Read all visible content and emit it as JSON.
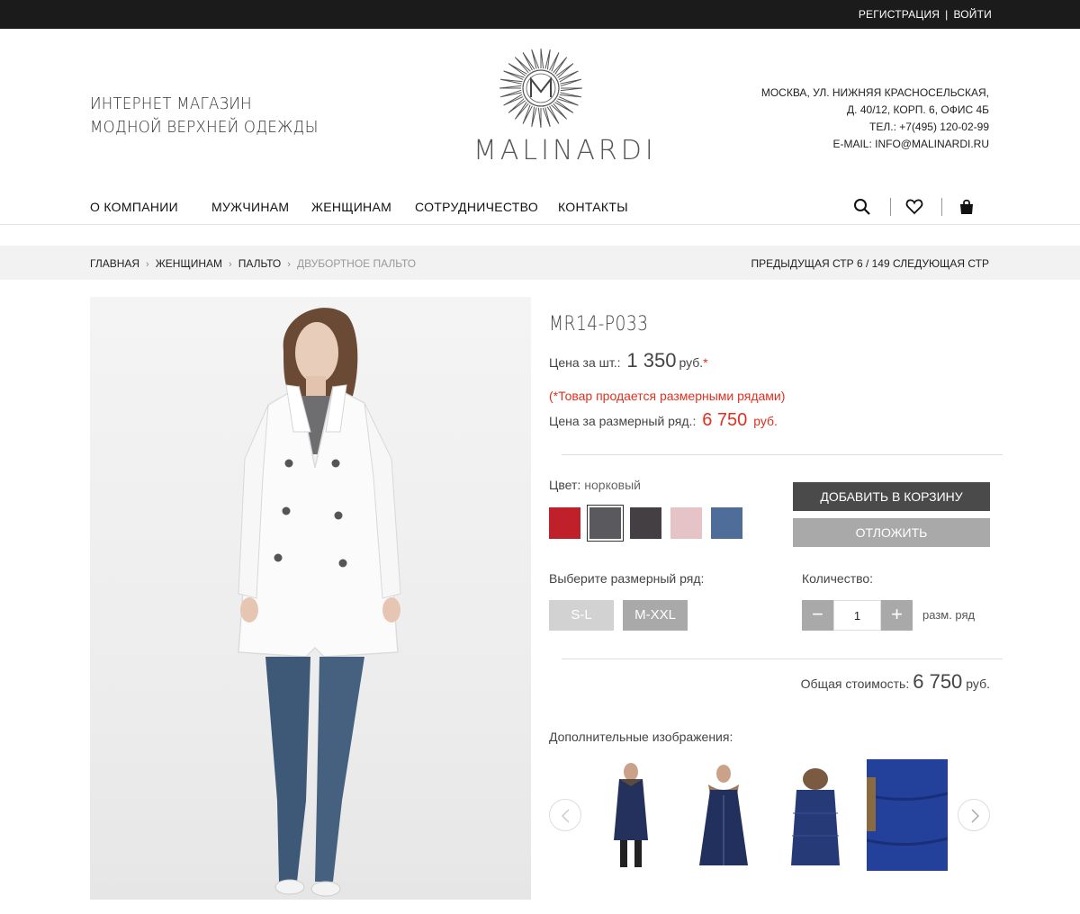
{
  "topbar": {
    "register": "РЕГИСТРАЦИЯ",
    "separator": "|",
    "login": "ВОЙТИ"
  },
  "header": {
    "tagline_line1": "ИНТЕРНЕТ МАГАЗИН",
    "tagline_line2": "МОДНОЙ ВЕРХНЕЙ ОДЕЖДЫ",
    "brand": "MALINARDI",
    "address_line1": "МОСКВА, УЛ. НИЖНЯЯ КРАСНОСЕЛЬСКАЯ,",
    "address_line2": "Д. 40/12, КОРП. 6, ОФИС 4Б",
    "phone": "ТЕЛ.: +7(495) 120-02-99",
    "email": "E-MAIL: INFO@MALINARDI.RU"
  },
  "nav": {
    "items": [
      "О КОМПАНИИ",
      "МУЖЧИНАМ",
      "ЖЕНЩИНАМ",
      "СОТРУДНИЧЕСТВО",
      "КОНТАКТЫ"
    ],
    "icons": [
      "search-icon",
      "heart-icon",
      "bag-icon"
    ]
  },
  "breadcrumb": {
    "items": [
      "ГЛАВНАЯ",
      "ЖЕНЩИНАМ",
      "ПАЛЬТО"
    ],
    "current": "ДВУБОРТНОЕ ПАЛЬТО",
    "pager": "ПРЕДЫДУЩАЯ СТР 6 / 149 СЛЕДУЮЩАЯ СТР"
  },
  "product": {
    "sku": "MR14-P033",
    "price_unit_label": "Цена за шт.:",
    "price_unit_value": "1 350",
    "price_unit_currency": "руб.",
    "price_unit_star": "*",
    "note": "(*Товар продается размерными рядами)",
    "price_row_label": "Цена за размерный ряд.:",
    "price_row_value": "6 750",
    "price_row_currency": "руб.",
    "color_label": "Цвет:",
    "color_value": "норковый",
    "colors": [
      "#c0202a",
      "#5a5a5e",
      "#433f42",
      "#e6c3c6",
      "#4f6d99"
    ],
    "selected_color_index": 1,
    "add_to_cart": "ДОБАВИТЬ В КОРЗИНУ",
    "postpone": "ОТЛОЖИТЬ",
    "size_label": "Выберите размерный ряд:",
    "sizes": [
      "S-L",
      "M-XXL"
    ],
    "qty_label": "Количество:",
    "qty_minus": "−",
    "qty_value": "1",
    "qty_plus": "+",
    "qty_unit": "разм. ряд",
    "total_label": "Общая стоимость:",
    "total_value": "6 750",
    "total_currency": "руб.",
    "extra_label": "Дополнительные изображения:"
  },
  "colors_ui": {
    "accent_red": "#e03020",
    "dark_button": "#4a4a4a",
    "grey_button": "#a9a9a9"
  }
}
